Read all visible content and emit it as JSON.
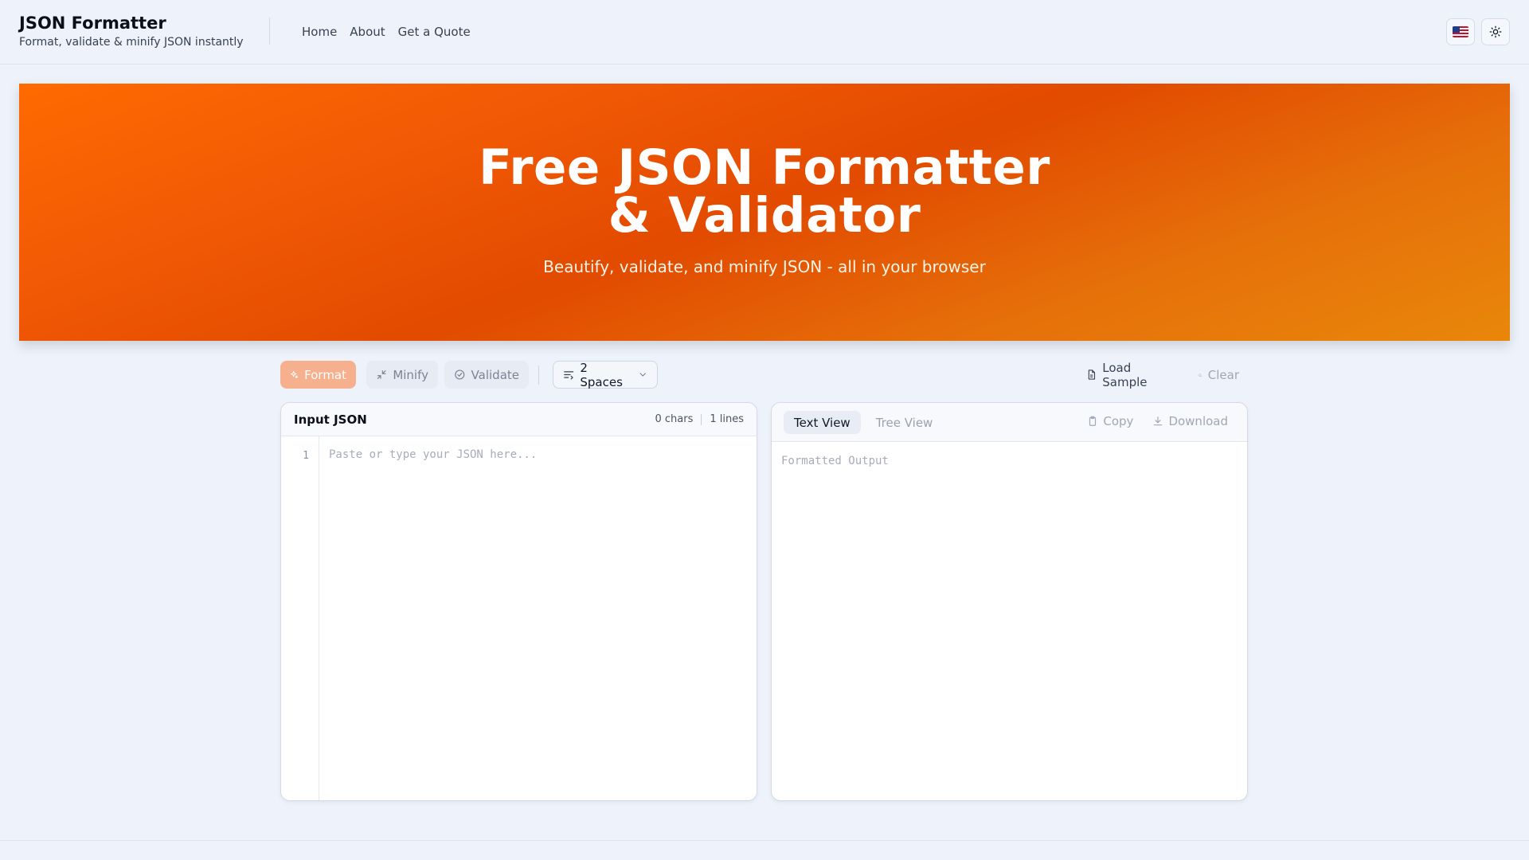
{
  "header": {
    "title": "JSON Formatter",
    "subtitle": "Format, validate & minify JSON instantly",
    "nav": [
      "Home",
      "About",
      "Get a Quote"
    ],
    "language_icon": "us-flag-icon",
    "theme_icon": "sun-icon"
  },
  "hero": {
    "title_line1": "Free JSON Formatter",
    "title_line2": "& Validator",
    "subtitle": "Beautify, validate, and minify JSON - all in your browser",
    "gradient_colors": [
      "#ff6a00",
      "#e24b00",
      "#e9870a"
    ]
  },
  "toolbar": {
    "format_label": "Format",
    "minify_label": "Minify",
    "validate_label": "Validate",
    "indent_label": "2 Spaces",
    "load_sample_label": "Load Sample",
    "clear_label": "Clear"
  },
  "input_panel": {
    "title": "Input JSON",
    "chars": "0 chars",
    "lines": "1 lines",
    "line_number": "1",
    "placeholder": "Paste or type your JSON here...",
    "value": ""
  },
  "output_panel": {
    "tabs": [
      "Text View",
      "Tree View"
    ],
    "active_tab": "Text View",
    "copy_label": "Copy",
    "download_label": "Download",
    "placeholder": "Formatted Output"
  },
  "colors": {
    "accent": "#f6b08d",
    "background": "#eef3fb"
  }
}
